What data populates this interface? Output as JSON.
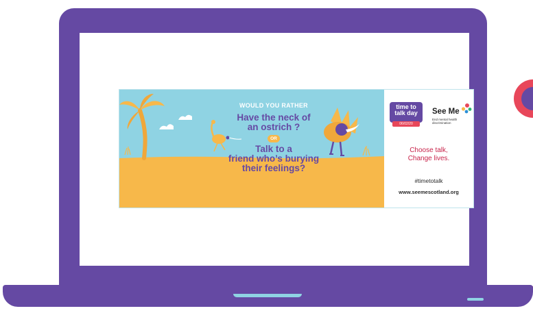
{
  "banner": {
    "prompt": "WOULD YOU RATHER",
    "option_one_line1": "Have the neck of",
    "option_one_line2": "an ostrich ?",
    "or_label": "OR",
    "option_two_line1": "Talk to a",
    "option_two_line2": "friend who’s burying",
    "option_two_line3": "their feelings?"
  },
  "brand": {
    "ttt_line1": "time to",
    "ttt_line2": "talk day",
    "ttt_date": "06/02/20",
    "seeme_name": "See Me",
    "seeme_tagline": "End mental health discrimination",
    "slogan_line1": "Choose talk,",
    "slogan_line2": "Change lives.",
    "hashtag": "#timetotalk",
    "website": "www.seemescotland.org"
  },
  "colors": {
    "laptop": "#6549a3",
    "accent_red": "#e8475a",
    "accent_cyan": "#8fd3e3",
    "sky": "#8fd3e3",
    "sand": "#f7b84a",
    "headline_purple": "#6549a3",
    "slogan": "#c8234a"
  },
  "icons": {
    "palm_tree": "palm-tree-icon",
    "ostrich": "ostrich-icon",
    "see_me_dots": "see-me-dots-icon"
  }
}
